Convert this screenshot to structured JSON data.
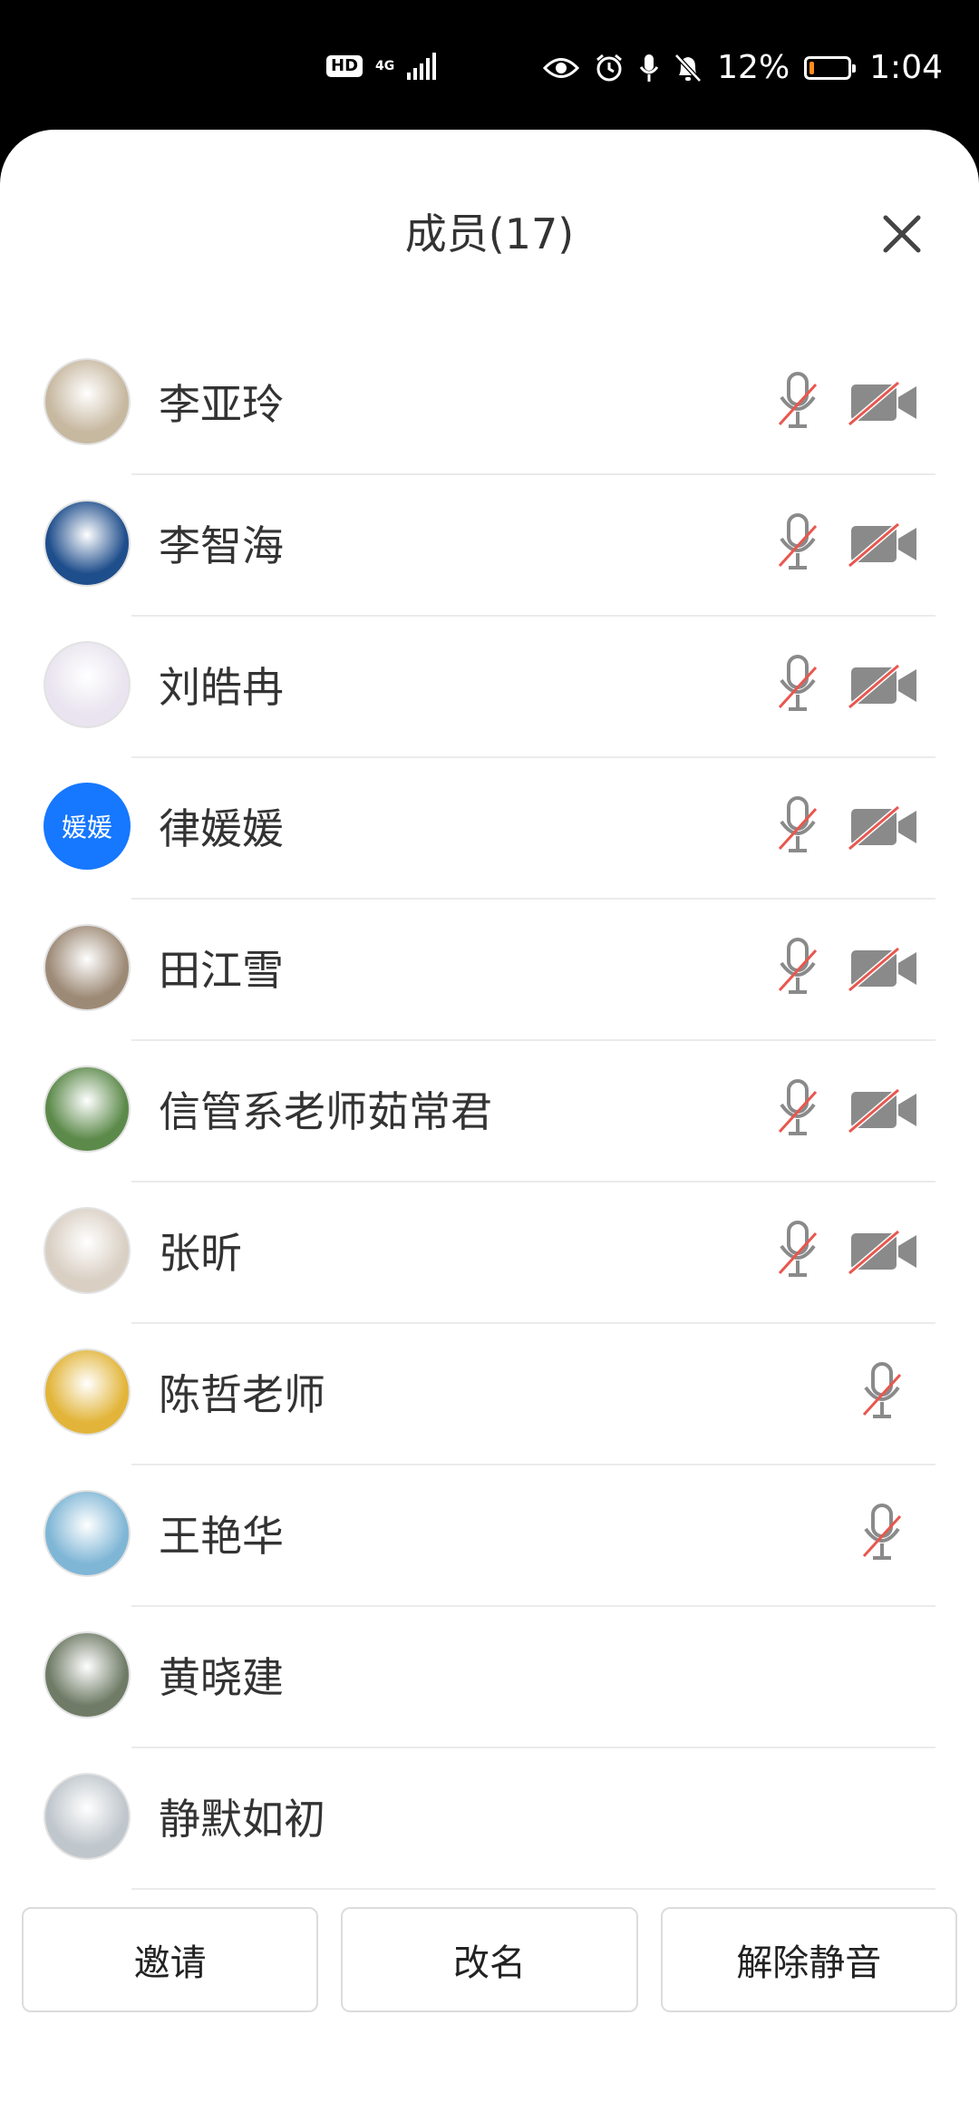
{
  "status_bar": {
    "hd": "HD",
    "network": "4G",
    "battery_percent": "12%",
    "time": "1:04",
    "battery_level": 0.12
  },
  "header": {
    "title": "成员(17)"
  },
  "members": [
    {
      "name": "李亚玲",
      "mic_muted": true,
      "camera_off": true,
      "avatar_color": "#c7b8a0"
    },
    {
      "name": "李智海",
      "mic_muted": true,
      "camera_off": true,
      "avatar_color": "#1f4e8c"
    },
    {
      "name": "刘皓冉",
      "mic_muted": true,
      "camera_off": true,
      "avatar_color": "#e9e4ef"
    },
    {
      "name": "律媛媛",
      "mic_muted": true,
      "camera_off": true,
      "avatar_text": "媛媛"
    },
    {
      "name": "田江雪",
      "mic_muted": true,
      "camera_off": true,
      "avatar_color": "#9d8a76"
    },
    {
      "name": "信管系老师茹常君",
      "mic_muted": true,
      "camera_off": true,
      "avatar_color": "#5c8a4a"
    },
    {
      "name": "张昕",
      "mic_muted": true,
      "camera_off": true,
      "avatar_color": "#d9cfc3"
    },
    {
      "name": "陈哲老师",
      "mic_muted": true,
      "camera_off": false,
      "avatar_color": "#e2b53a"
    },
    {
      "name": "王艳华",
      "mic_muted": true,
      "camera_off": false,
      "avatar_color": "#7fb6d6"
    },
    {
      "name": "黄晓建",
      "mic_muted": false,
      "camera_off": false,
      "avatar_color": "#6f7b66"
    },
    {
      "name": "静默如初",
      "mic_muted": false,
      "camera_off": false,
      "avatar_color": "#bfc6cc"
    }
  ],
  "actions": {
    "invite": "邀请",
    "rename": "改名",
    "unmute": "解除静音"
  },
  "colors": {
    "mute_slash": "#e8574f",
    "icon_gray": "#8a8a8a",
    "accent": "#1677ff"
  }
}
